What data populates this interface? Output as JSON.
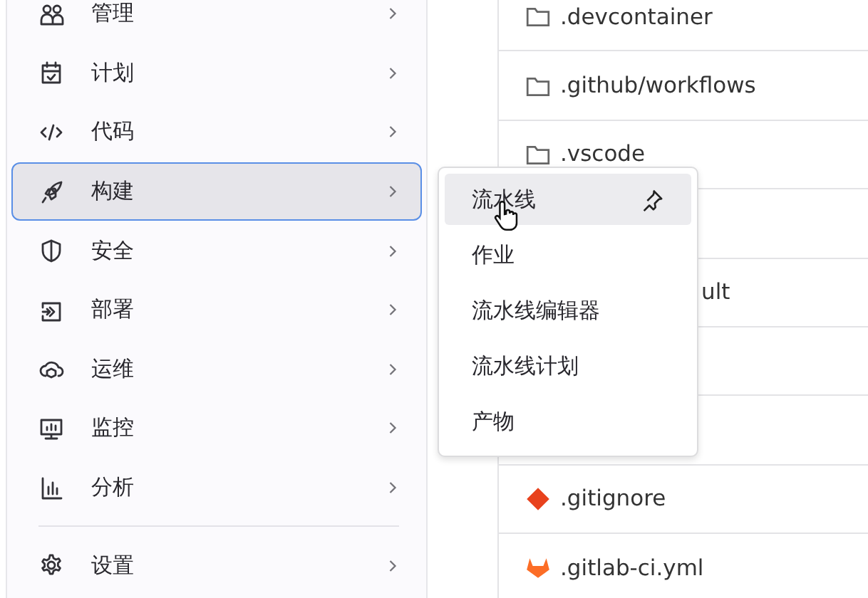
{
  "sidebar": {
    "items": [
      {
        "label": "管理",
        "selected": false
      },
      {
        "label": "计划",
        "selected": false
      },
      {
        "label": "代码",
        "selected": false
      },
      {
        "label": "构建",
        "selected": true
      },
      {
        "label": "安全",
        "selected": false
      },
      {
        "label": "部署",
        "selected": false
      },
      {
        "label": "运维",
        "selected": false
      },
      {
        "label": "监控",
        "selected": false
      },
      {
        "label": "分析",
        "selected": false
      }
    ],
    "settings": {
      "label": "设置",
      "selected": false
    }
  },
  "files": [
    {
      "kind": "folder",
      "name": ".devcontainer"
    },
    {
      "kind": "folder",
      "name": ".github/workflows"
    },
    {
      "kind": "folder",
      "name": ".vscode"
    },
    {
      "kind": "hidden"
    },
    {
      "kind": "covered",
      "name": "ult"
    },
    {
      "kind": "hidden"
    },
    {
      "kind": "hidden"
    },
    {
      "kind": "git",
      "name": ".gitignore"
    },
    {
      "kind": "gitlab",
      "name": ".gitlab-ci.yml"
    }
  ],
  "flyout_menu": {
    "items": [
      {
        "label": "流水线",
        "selected": true,
        "pinned": true
      },
      {
        "label": "作业",
        "selected": false,
        "pinned": false
      },
      {
        "label": "流水线编辑器",
        "selected": false,
        "pinned": false
      },
      {
        "label": "流水线计划",
        "selected": false,
        "pinned": false
      },
      {
        "label": "产物",
        "selected": false,
        "pinned": false
      }
    ]
  }
}
